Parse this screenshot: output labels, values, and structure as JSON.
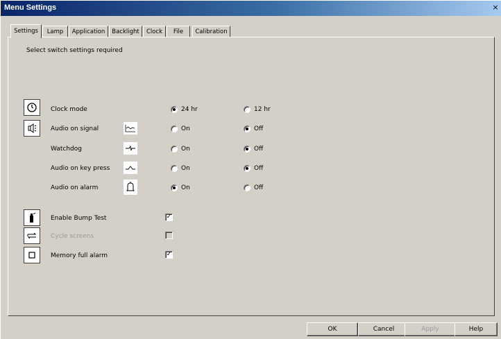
{
  "window": {
    "title": "Menu Settings",
    "close_glyph": "×"
  },
  "tabs": [
    {
      "label": "Settings",
      "active": true
    },
    {
      "label": "Lamp"
    },
    {
      "label": "Application"
    },
    {
      "label": "Backlight"
    },
    {
      "label": "Clock"
    },
    {
      "label": "File"
    },
    {
      "label": "Calibration"
    }
  ],
  "instruction": "Select switch settings required",
  "settings": [
    {
      "label": "Clock mode",
      "option_a": "24 hr",
      "option_b": "12 hr",
      "selected": "a",
      "icon": "clock-icon"
    },
    {
      "label": "Audio on signal",
      "option_a": "On",
      "option_b": "Off",
      "selected": "b",
      "icon": "speaker-icon",
      "mini_icon": "signal-graph-icon"
    },
    {
      "label": "Watchdog",
      "option_a": "On",
      "option_b": "Off",
      "selected": "b",
      "mini_icon": "watchdog-wave-icon"
    },
    {
      "label": "Audio on key press",
      "option_a": "On",
      "option_b": "Off",
      "selected": "b",
      "mini_icon": "keypress-wave-icon"
    },
    {
      "label": "Audio on alarm",
      "option_a": "On",
      "option_b": "Off",
      "selected": "a",
      "mini_icon": "bell-icon"
    }
  ],
  "checks": [
    {
      "label": "Enable Bump Test",
      "checked": true,
      "disabled": false,
      "icon": "gas-cylinder-icon"
    },
    {
      "label": "Cycle screens",
      "checked": false,
      "disabled": true,
      "icon": "cycle-arrows-icon"
    },
    {
      "label": "Memory full alarm",
      "checked": true,
      "disabled": false,
      "icon": "memory-square-icon"
    }
  ],
  "buttons": {
    "ok": "OK",
    "cancel": "Cancel",
    "apply": "Apply",
    "help": "Help"
  }
}
